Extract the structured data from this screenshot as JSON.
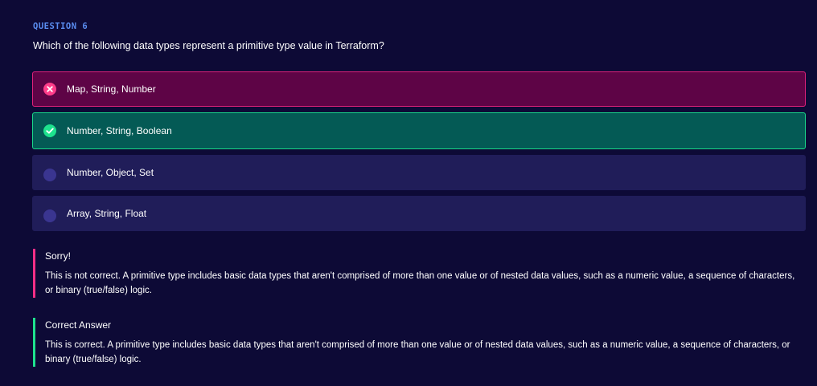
{
  "question": {
    "label": "QUESTION 6",
    "text": "Which of the following data types represent a primitive type value in Terraform?"
  },
  "options": [
    {
      "label": "Map, String, Number",
      "state": "incorrect-selected",
      "icon": "close-icon"
    },
    {
      "label": "Number, String, Boolean",
      "state": "correct",
      "icon": "check-icon"
    },
    {
      "label": "Number, Object, Set",
      "state": "unselected",
      "icon": "radio-icon"
    },
    {
      "label": "Array, String, Float",
      "state": "unselected",
      "icon": "radio-icon"
    }
  ],
  "feedback": {
    "incorrect": {
      "title": "Sorry!",
      "body": "This is not correct. A primitive type includes basic data types that aren't comprised of more than one value or of nested data values, such as a numeric value, a sequence of characters, or binary (true/false) logic."
    },
    "correct": {
      "title": "Correct Answer",
      "body": "This is correct. A primitive type includes basic data types that aren't comprised of more than one value or of nested data values, such as a numeric value, a sequence of characters, or binary (true/false) logic."
    }
  },
  "colors": {
    "background": "#0d0a36",
    "question_label": "#5a8df0",
    "incorrect": "#e0217a",
    "correct": "#19d88a",
    "neutral": "#201d59"
  }
}
